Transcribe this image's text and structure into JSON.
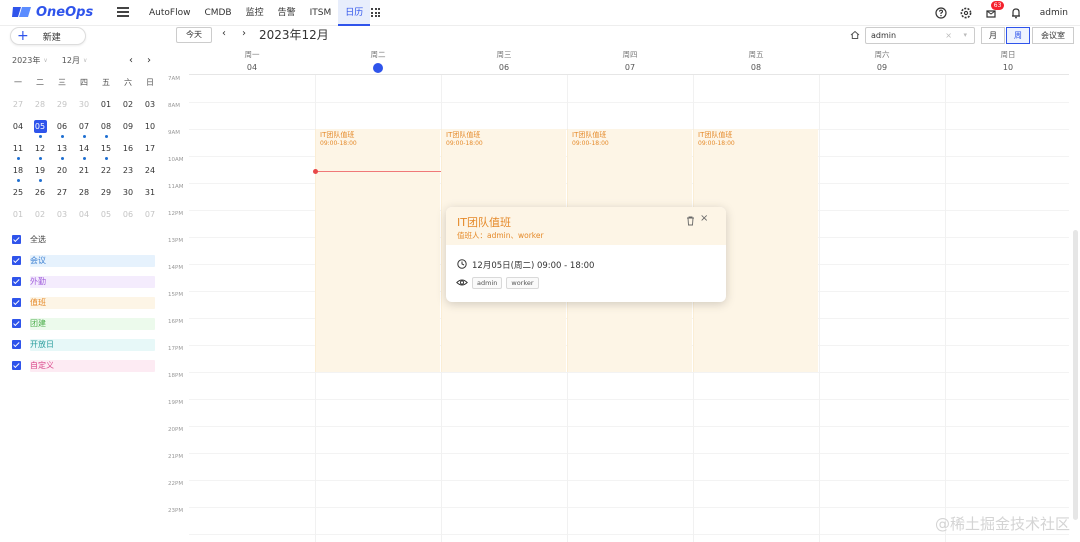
{
  "app": {
    "logo_text": "OneOps",
    "username": "admin",
    "notification_count": "63"
  },
  "nav": [
    {
      "label": "AutoFlow",
      "active": false
    },
    {
      "label": "CMDB",
      "active": false
    },
    {
      "label": "监控",
      "active": false
    },
    {
      "label": "告警",
      "active": false
    },
    {
      "label": "ITSM",
      "active": false
    },
    {
      "label": "日历",
      "active": true
    }
  ],
  "sidebar": {
    "new_label": "新建",
    "year_label": "2023年",
    "month_label": "12月",
    "weekdays": [
      "一",
      "二",
      "三",
      "四",
      "五",
      "六",
      "日"
    ],
    "weeks": [
      [
        {
          "d": "27",
          "dim": true
        },
        {
          "d": "28",
          "dim": true
        },
        {
          "d": "29",
          "dim": true
        },
        {
          "d": "30",
          "dim": true
        },
        {
          "d": "01"
        },
        {
          "d": "02"
        },
        {
          "d": "03"
        }
      ],
      [
        {
          "d": "04"
        },
        {
          "d": "05",
          "today": true,
          "dot": true
        },
        {
          "d": "06",
          "dot": true
        },
        {
          "d": "07",
          "dot": true
        },
        {
          "d": "08",
          "dot": true
        },
        {
          "d": "09"
        },
        {
          "d": "10"
        }
      ],
      [
        {
          "d": "11",
          "dot": true
        },
        {
          "d": "12",
          "dot": true
        },
        {
          "d": "13",
          "dot": true
        },
        {
          "d": "14",
          "dot": true
        },
        {
          "d": "15",
          "dot": true
        },
        {
          "d": "16"
        },
        {
          "d": "17"
        }
      ],
      [
        {
          "d": "18",
          "dot": true
        },
        {
          "d": "19",
          "dot": true
        },
        {
          "d": "20"
        },
        {
          "d": "21"
        },
        {
          "d": "22"
        },
        {
          "d": "23"
        },
        {
          "d": "24"
        }
      ],
      [
        {
          "d": "25"
        },
        {
          "d": "26"
        },
        {
          "d": "27"
        },
        {
          "d": "28"
        },
        {
          "d": "29"
        },
        {
          "d": "30"
        },
        {
          "d": "31"
        }
      ],
      [
        {
          "d": "01",
          "dim": true
        },
        {
          "d": "02",
          "dim": true
        },
        {
          "d": "03",
          "dim": true
        },
        {
          "d": "04",
          "dim": true
        },
        {
          "d": "05",
          "dim": true
        },
        {
          "d": "06",
          "dim": true
        },
        {
          "d": "07",
          "dim": true
        }
      ]
    ],
    "categories": [
      {
        "label": "全选",
        "bg": "#ffffff",
        "color": "#444444"
      },
      {
        "label": "会议",
        "bg": "#e6f2fd",
        "color": "#3b7fd1"
      },
      {
        "label": "外勤",
        "bg": "#f4ecfd",
        "color": "#a15fdc"
      },
      {
        "label": "值班",
        "bg": "#fdf5e6",
        "color": "#e58a2a"
      },
      {
        "label": "团建",
        "bg": "#ecfaec",
        "color": "#4cae4c"
      },
      {
        "label": "开放日",
        "bg": "#e7f8f8",
        "color": "#2a9d9d"
      },
      {
        "label": "自定义",
        "bg": "#fdebf3",
        "color": "#d9468a"
      }
    ]
  },
  "toolbar": {
    "today_label": "今天",
    "current_month": "2023年12月",
    "user_filter": "admin",
    "views": [
      "月",
      "周",
      "会议室"
    ],
    "active_view": "周"
  },
  "week": {
    "days": [
      {
        "weekday": "周一",
        "date": "04"
      },
      {
        "weekday": "周二",
        "date": "05",
        "today": true
      },
      {
        "weekday": "周三",
        "date": "06"
      },
      {
        "weekday": "周四",
        "date": "07"
      },
      {
        "weekday": "周五",
        "date": "08"
      },
      {
        "weekday": "周六",
        "date": "09"
      },
      {
        "weekday": "周日",
        "date": "10"
      }
    ],
    "hours": [
      "7AM",
      "8AM",
      "9AM",
      "10AM",
      "11AM",
      "12PM",
      "13PM",
      "14PM",
      "15PM",
      "16PM",
      "17PM",
      "18PM",
      "19PM",
      "20PM",
      "21PM",
      "22PM",
      "23PM"
    ],
    "events": [
      {
        "day": 1,
        "title": "IT团队值班",
        "time": "09:00-18:00",
        "start": 9,
        "end": 18
      },
      {
        "day": 2,
        "title": "IT团队值班",
        "time": "09:00-18:00",
        "start": 9,
        "end": 18
      },
      {
        "day": 3,
        "title": "IT团队值班",
        "time": "09:00-18:00",
        "start": 9,
        "end": 18
      },
      {
        "day": 4,
        "title": "IT团队值班",
        "time": "09:00-18:00",
        "start": 9,
        "end": 18
      }
    ],
    "now_hour": 10.55
  },
  "popup": {
    "title": "IT团队值班",
    "owner": "值班人：admin、worker",
    "time": "12月05日(周二) 09:00 - 18:00",
    "tags": [
      "admin",
      "worker"
    ]
  },
  "watermark": "@稀土掘金技术社区",
  "colors": {
    "accent": "#2f54eb",
    "duty": "#e58a2a",
    "duty_bg": "#fdf5e6"
  }
}
